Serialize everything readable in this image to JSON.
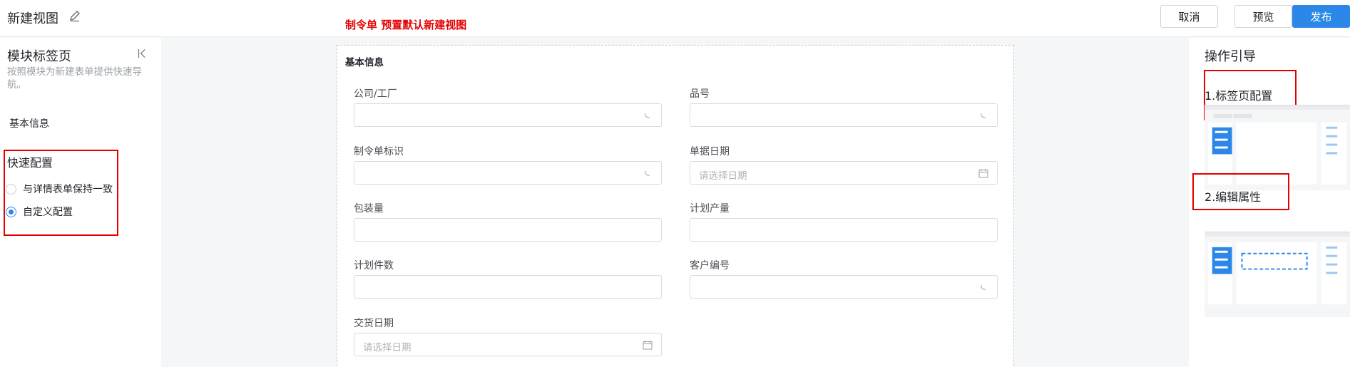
{
  "header": {
    "title": "新建视图",
    "note": "制令单 预置默认新建视图",
    "buttons": {
      "cancel": "取消",
      "preview": "预览",
      "publish": "发布"
    }
  },
  "left_panel": {
    "title": "模块标签页",
    "description": "按照模块为新建表单提供快速导航。",
    "items": [
      "基本信息"
    ],
    "quick_config": {
      "title": "快速配置",
      "options": [
        {
          "label": "与详情表单保持一致",
          "checked": false
        },
        {
          "label": "自定义配置",
          "checked": true
        }
      ]
    }
  },
  "form": {
    "section_title": "基本信息",
    "fields": [
      {
        "label": "公司/工厂",
        "placeholder": "",
        "type": "select"
      },
      {
        "label": "品号",
        "placeholder": "",
        "type": "select"
      },
      {
        "label": "制令单标识",
        "placeholder": "",
        "type": "select"
      },
      {
        "label": "单据日期",
        "placeholder": "请选择日期",
        "type": "date"
      },
      {
        "label": "包装量",
        "placeholder": "",
        "type": "text"
      },
      {
        "label": "计划产量",
        "placeholder": "",
        "type": "text"
      },
      {
        "label": "计划件数",
        "placeholder": "",
        "type": "text"
      },
      {
        "label": "客户编号",
        "placeholder": "",
        "type": "select"
      },
      {
        "label": "交货日期",
        "placeholder": "请选择日期",
        "type": "date"
      }
    ]
  },
  "right_panel": {
    "title": "操作引导",
    "steps": [
      "1.标签页配置",
      "2.编辑属性"
    ]
  },
  "colors": {
    "accent": "#2b88e8",
    "annotation_red": "#e60000"
  }
}
